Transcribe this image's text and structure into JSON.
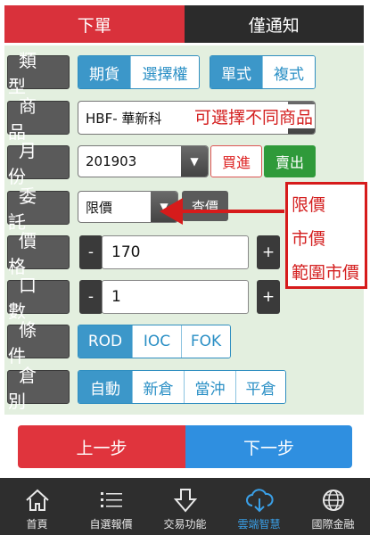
{
  "top_tabs": [
    {
      "label": "下單",
      "active": true
    },
    {
      "label": "僅通知",
      "active": false
    }
  ],
  "rows": {
    "type": {
      "label": "類型",
      "options": [
        "期貨",
        "選擇權"
      ],
      "selected": 0,
      "mode_options": [
        "單式",
        "複式"
      ],
      "mode_selected": 0
    },
    "product": {
      "label": "商品",
      "value": "HBF- 華新科"
    },
    "month": {
      "label": "月份",
      "value": "201903",
      "buy": "買進",
      "sell": "賣出"
    },
    "order": {
      "label": "委託",
      "value": "限價",
      "query": "查價"
    },
    "price": {
      "label": "價格",
      "minus": "-",
      "plus": "+",
      "value": "170"
    },
    "quantity": {
      "label": "口數",
      "minus": "-",
      "plus": "+",
      "value": "1"
    },
    "condition": {
      "label": "條件",
      "options": [
        "ROD",
        "IOC",
        "FOK"
      ],
      "selected": 0
    },
    "position": {
      "label": "倉別",
      "options": [
        "自動",
        "新倉",
        "當沖",
        "平倉"
      ],
      "selected": 0
    }
  },
  "annotations": {
    "product_note": "可選擇不同商品",
    "order_types": [
      "限價",
      "市價",
      "範圍市價"
    ],
    "color": "#d61b1b"
  },
  "nav": {
    "prev": "上一步",
    "next": "下一步"
  },
  "tab_bar": [
    {
      "label": "首頁",
      "icon": "home-icon"
    },
    {
      "label": "自選報價",
      "icon": "list-icon"
    },
    {
      "label": "交易功能",
      "icon": "trade-icon"
    },
    {
      "label": "雲端智慧",
      "icon": "cloud-icon",
      "active": true
    },
    {
      "label": "國際金融",
      "icon": "globe-icon"
    }
  ],
  "colors": {
    "accent_red": "#d9313b",
    "accent_blue": "#2f8fe0",
    "buy_sell_green": "#2f9a3a",
    "form_bg": "#e3efdf"
  }
}
